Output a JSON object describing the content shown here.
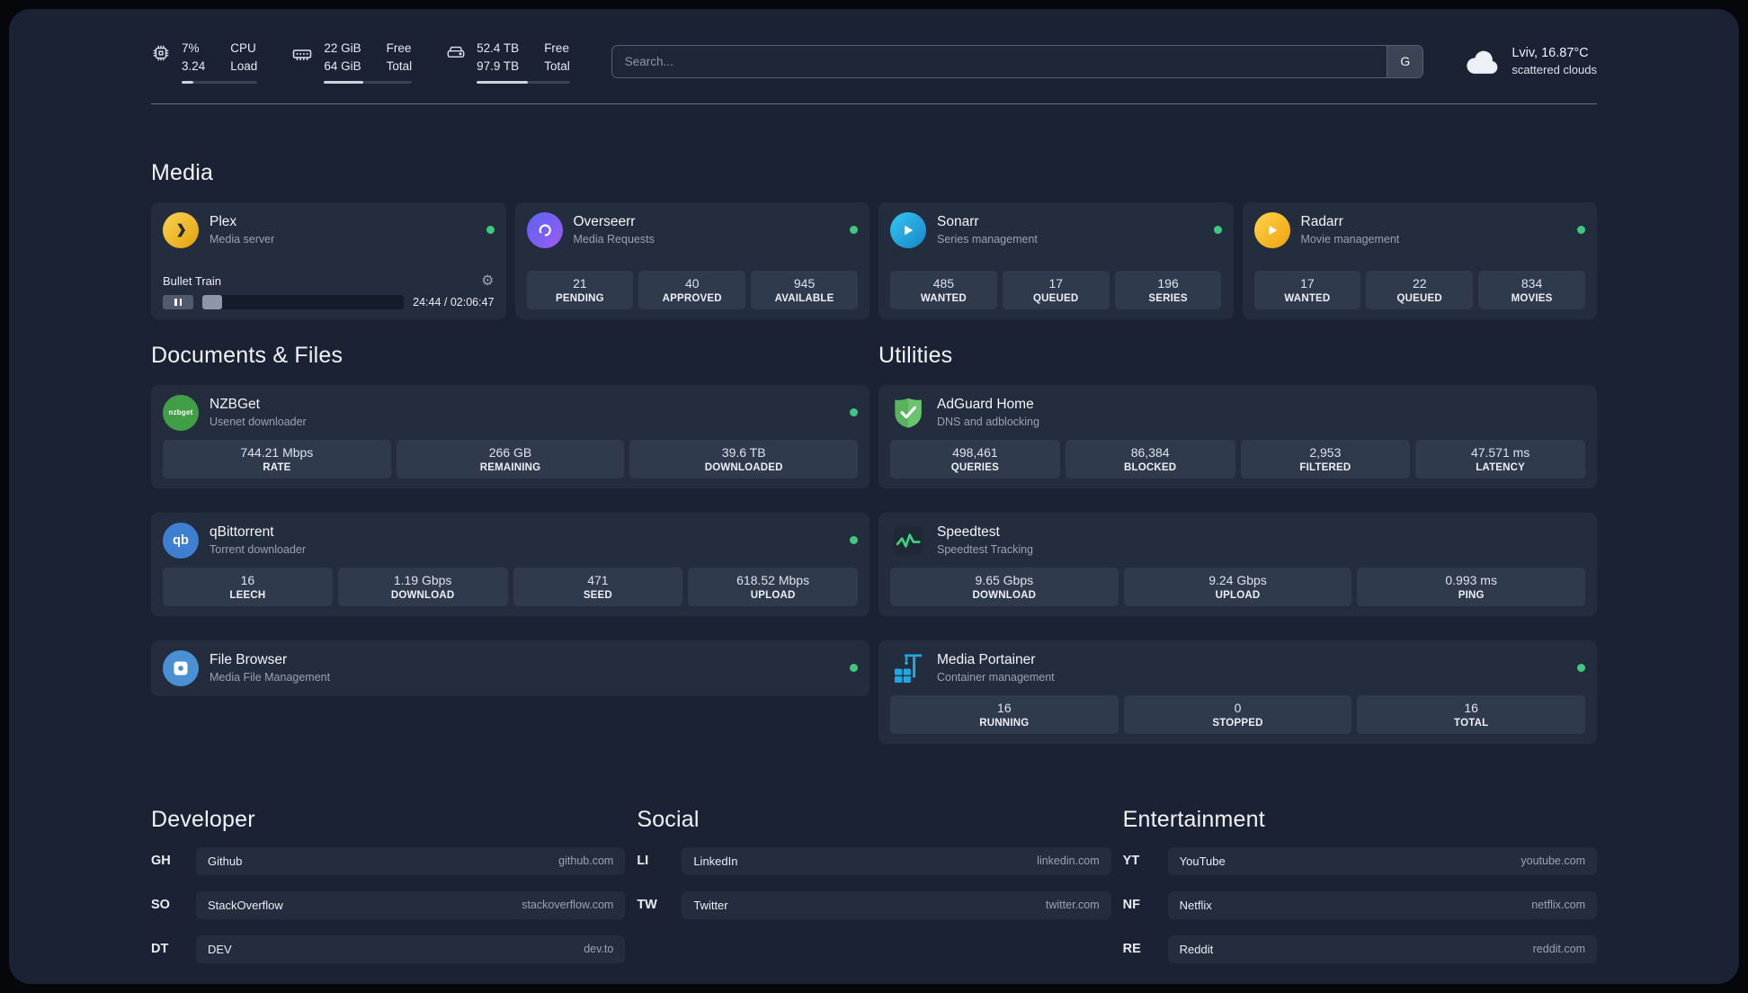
{
  "topbar": {
    "cpu": {
      "value_top": "7%",
      "value_bottom": "3.24",
      "label_top": "CPU",
      "label_bottom": "Load",
      "progress_style": "width:16%"
    },
    "ram": {
      "value_top": "22 GiB",
      "value_bottom": "64 GiB",
      "label_top": "Free",
      "label_bottom": "Total",
      "progress_style": "width:45%"
    },
    "disk": {
      "value_top": "52.4 TB",
      "value_bottom": "97.9 TB",
      "label_top": "Free",
      "label_bottom": "Total",
      "progress_style": "width:55%"
    },
    "search": {
      "placeholder": "Search...",
      "engine_button": "G"
    },
    "weather": {
      "location": "Lviv, 16.87°C",
      "condition": "scattered clouds"
    }
  },
  "sections": {
    "media": {
      "title": "Media",
      "plex": {
        "name": "Plex",
        "description": "Media server",
        "player": {
          "track": "Bullet Train",
          "time": "24:44 / 02:06:47",
          "progress_style": "width:10%"
        }
      },
      "overseerr": {
        "name": "Overseerr",
        "description": "Media Requests",
        "stats": [
          {
            "value": "21",
            "label": "PENDING"
          },
          {
            "value": "40",
            "label": "APPROVED"
          },
          {
            "value": "945",
            "label": "AVAILABLE"
          }
        ]
      },
      "sonarr": {
        "name": "Sonarr",
        "description": "Series management",
        "stats": [
          {
            "value": "485",
            "label": "WANTED"
          },
          {
            "value": "17",
            "label": "QUEUED"
          },
          {
            "value": "196",
            "label": "SERIES"
          }
        ]
      },
      "radarr": {
        "name": "Radarr",
        "description": "Movie management",
        "stats": [
          {
            "value": "17",
            "label": "WANTED"
          },
          {
            "value": "22",
            "label": "QUEUED"
          },
          {
            "value": "834",
            "label": "MOVIES"
          }
        ]
      }
    },
    "documents": {
      "title": "Documents & Files",
      "nzbget": {
        "name": "NZBGet",
        "description": "Usenet downloader",
        "icon_text": "nzbget",
        "stats": [
          {
            "value": "744.21 Mbps",
            "label": "RATE"
          },
          {
            "value": "266 GB",
            "label": "REMAINING"
          },
          {
            "value": "39.6 TB",
            "label": "DOWNLOADED"
          }
        ]
      },
      "qbittorrent": {
        "name": "qBittorrent",
        "description": "Torrent downloader",
        "icon_text": "qb",
        "stats": [
          {
            "value": "16",
            "label": "LEECH"
          },
          {
            "value": "1.19 Gbps",
            "label": "DOWNLOAD"
          },
          {
            "value": "471",
            "label": "SEED"
          },
          {
            "value": "618.52 Mbps",
            "label": "UPLOAD"
          }
        ]
      },
      "filebrowser": {
        "name": "File Browser",
        "description": "Media File Management"
      }
    },
    "utilities": {
      "title": "Utilities",
      "adguard": {
        "name": "AdGuard Home",
        "description": "DNS and adblocking",
        "stats": [
          {
            "value": "498,461",
            "label": "QUERIES"
          },
          {
            "value": "86,384",
            "label": "BLOCKED"
          },
          {
            "value": "2,953",
            "label": "FILTERED"
          },
          {
            "value": "47.571 ms",
            "label": "LATENCY"
          }
        ]
      },
      "speedtest": {
        "name": "Speedtest",
        "description": "Speedtest Tracking",
        "stats": [
          {
            "value": "9.65 Gbps",
            "label": "DOWNLOAD"
          },
          {
            "value": "9.24 Gbps",
            "label": "UPLOAD"
          },
          {
            "value": "0.993 ms",
            "label": "PING"
          }
        ]
      },
      "portainer": {
        "name": "Media Portainer",
        "description": "Container management",
        "stats": [
          {
            "value": "16",
            "label": "RUNNING"
          },
          {
            "value": "0",
            "label": "STOPPED"
          },
          {
            "value": "16",
            "label": "TOTAL"
          }
        ]
      }
    },
    "bookmarks": {
      "developer": {
        "title": "Developer",
        "items": [
          {
            "abbr": "GH",
            "name": "Github",
            "url": "github.com"
          },
          {
            "abbr": "SO",
            "name": "StackOverflow",
            "url": "stackoverflow.com"
          },
          {
            "abbr": "DT",
            "name": "DEV",
            "url": "dev.to"
          }
        ]
      },
      "social": {
        "title": "Social",
        "items": [
          {
            "abbr": "LI",
            "name": "LinkedIn",
            "url": "linkedin.com"
          },
          {
            "abbr": "TW",
            "name": "Twitter",
            "url": "twitter.com"
          }
        ]
      },
      "entertainment": {
        "title": "Entertainment",
        "items": [
          {
            "abbr": "YT",
            "name": "YouTube",
            "url": "youtube.com"
          },
          {
            "abbr": "NF",
            "name": "Netflix",
            "url": "netflix.com"
          },
          {
            "abbr": "RE",
            "name": "Reddit",
            "url": "reddit.com"
          }
        ]
      }
    }
  },
  "icons": {
    "gear": "⚙"
  },
  "colors": {
    "status_online": "#3ec97e",
    "accent_green": "#3ed47e",
    "page_bg": "#1a2233",
    "card_bg": "#242d3e",
    "tile_bg": "#303a4d"
  }
}
